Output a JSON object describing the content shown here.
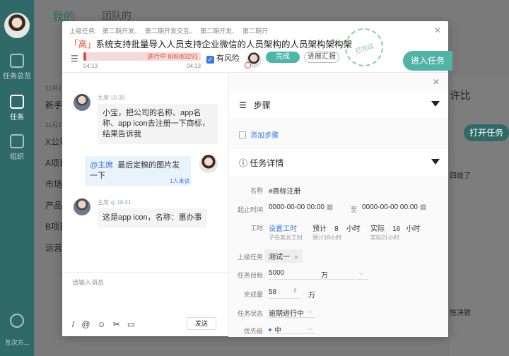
{
  "background": {
    "tabs": [
      "我的",
      "团队的"
    ],
    "sidebar": [
      {
        "label": "任务总览"
      },
      {
        "label": "任务"
      },
      {
        "label": "组织"
      }
    ],
    "bottom_label": "互次方...",
    "list_dates": [
      "11月2",
      "11月2"
    ],
    "list_items": [
      "新手",
      "X公司",
      "A项目",
      "市场",
      "产品",
      "B项目",
      "运营"
    ],
    "right_text_1": "许比",
    "right_button": "打开任务",
    "right_text_2": "四给了",
    "right_text_3": "性决敦"
  },
  "task": {
    "parent_label": "上级任务:",
    "parents": [
      "第二期开发、",
      "第二期开发交互、",
      "第二期开发、",
      "第二期开"
    ],
    "priority": "「高」",
    "title": "系统支持批量导入人员支持企业微信的人员架构的人员架构架构架",
    "stamp": "已完成",
    "progress_text": "进行中 899/83291",
    "progress_start": "04:13",
    "progress_end": "04:13",
    "risk_label": "有风险",
    "done_button": "完成",
    "report_button": "进展汇报",
    "enter_button": "进入任务"
  },
  "chat": {
    "messages": [
      {
        "name": "主席",
        "time": "16:38",
        "text": "小宝，把公司的名称、app名称、app icon去注册一下商标，结果告诉我"
      },
      {
        "at": "@主席",
        "text": "最后定稿的图片发一下",
        "unread": "1人未读"
      },
      {
        "name": "主席",
        "time": "16:41",
        "text": "这是app icon，名称：惠办事"
      }
    ],
    "input_placeholder": "请输入消息",
    "send_button": "发送"
  },
  "detail": {
    "steps_title": "步骤",
    "add_step": "添加步骤",
    "info_title": "任务详情",
    "fields": {
      "name_label": "名称",
      "name_value": "#商标注册",
      "time_label": "起止时间",
      "start": "0000-00-00 00:00",
      "to": "至",
      "end": "0000-00-00 00:00",
      "hours_label": "工时",
      "set_hours": "设置工时",
      "est_label": "预计",
      "est_value": "8",
      "est_unit": "小时",
      "actual_label": "实际",
      "actual_value": "16",
      "actual_unit": "小时",
      "sub_total": "子任务总工时",
      "sub_est": "预计18小时",
      "sub_actual": "实际21小时",
      "parent_label": "上级任务",
      "parent_tag": "测试一",
      "target_label": "任务目标",
      "target_value": "5000",
      "target_unit": "万",
      "done_label": "完成量",
      "done_value": "58",
      "done_unit": "万",
      "status_label": "任务状态",
      "status_value": "逾期进行中",
      "priority_label": "优先级",
      "priority_value": "中"
    }
  },
  "colors": {
    "accent": "#4ab7a8",
    "link": "#3b7be0",
    "danger": "#e24b3b"
  }
}
